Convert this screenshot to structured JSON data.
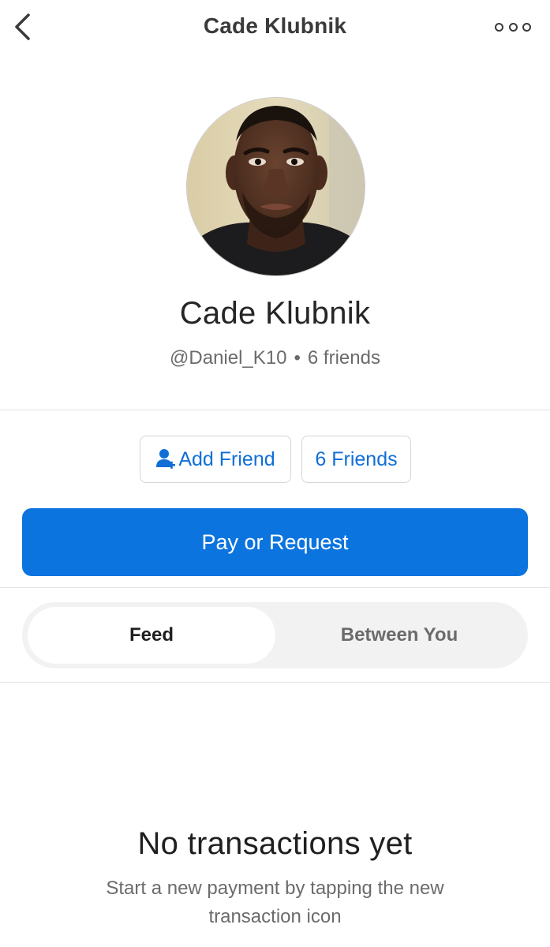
{
  "header": {
    "title": "Cade Klubnik",
    "back_icon": "chevron-left-icon",
    "more_icon": "more-horizontal-icon"
  },
  "profile": {
    "display_name": "Cade Klubnik",
    "username": "@Daniel_K10",
    "separator": "•",
    "friend_count_text": "6 friends",
    "avatar": "profile-photo"
  },
  "actions": {
    "add_friend_label": "Add Friend",
    "add_friend_icon": "add-person-icon",
    "friends_label": "6 Friends",
    "pay_label": "Pay or Request"
  },
  "tabs": [
    {
      "label": "Feed",
      "active": true
    },
    {
      "label": "Between You",
      "active": false
    }
  ],
  "empty_state": {
    "title": "No transactions yet",
    "subtitle": "Start a new payment by tapping the new transaction icon"
  },
  "colors": {
    "accent": "#0b74de",
    "link": "#0f6fd6",
    "muted_text": "#6b6b6b",
    "segment_bg": "#f2f2f3"
  }
}
